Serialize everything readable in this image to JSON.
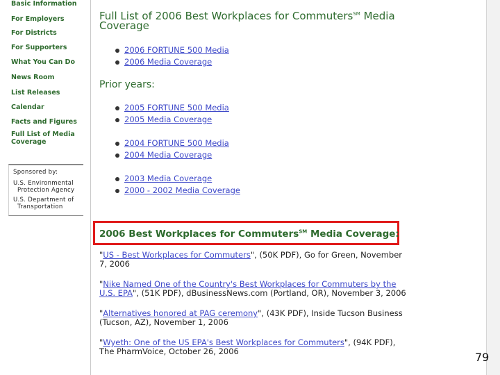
{
  "sidebar": {
    "items": [
      "Basic Information",
      "For Employers",
      "For Districts",
      "For Supporters",
      "What You Can Do",
      "News Room",
      "List Releases",
      "Calendar",
      "Facts and Figures",
      "Full List of Media Coverage"
    ],
    "sponsor": {
      "label": "Sponsored by:",
      "line1": "U.S. Environmental",
      "line2": "Protection Agency",
      "line3": "U.S. Department of",
      "line4": "Transportation"
    }
  },
  "main": {
    "title_line1": "Full List of 2006 Best Workplaces for Commuters",
    "title_sm": "SM",
    "title_line1_end": " Media",
    "title_line2": "Coverage",
    "current_links": [
      "2006 FORTUNE 500 Media",
      "2006 Media Coverage"
    ],
    "prior_heading": "Prior years:",
    "prior_links": [
      "2005 FORTUNE 500 Media",
      "2005 Media Coverage",
      "2004 FORTUNE 500 Media",
      "2004 Media Coverage",
      "2003 Media Coverage",
      "2000 - 2002 Media Coverage"
    ],
    "section_heading": "2006 Best Workplaces for Commuters",
    "section_sm": "SM",
    "section_heading_end": " Media Coverage:",
    "entries": [
      {
        "link": "US - Best Workplaces for Commuters",
        "rest": "\", (50K PDF), Go for Green, November 7, 2006"
      },
      {
        "link": "Nike Named One of the Country's Best Workplaces for Commuters by the U.S. EPA",
        "rest": "\", (51K PDF), dBusinessNews.com (Portland, OR), November 3, 2006"
      },
      {
        "link": "Alternatives honored at PAG ceremony",
        "rest": "\", (43K PDF), Inside Tucson Business (Tucson, AZ), November 1, 2006"
      },
      {
        "link": "Wyeth: One of the US EPA's Best Workplaces for Commuters",
        "rest": "\", (94K PDF), The PharmVoice, October 26, 2006"
      }
    ]
  },
  "page_number": "79",
  "colors": {
    "heading_green": "#2e6b2e",
    "link_blue": "#3d48c9",
    "highlight_red": "#e01a1a"
  }
}
